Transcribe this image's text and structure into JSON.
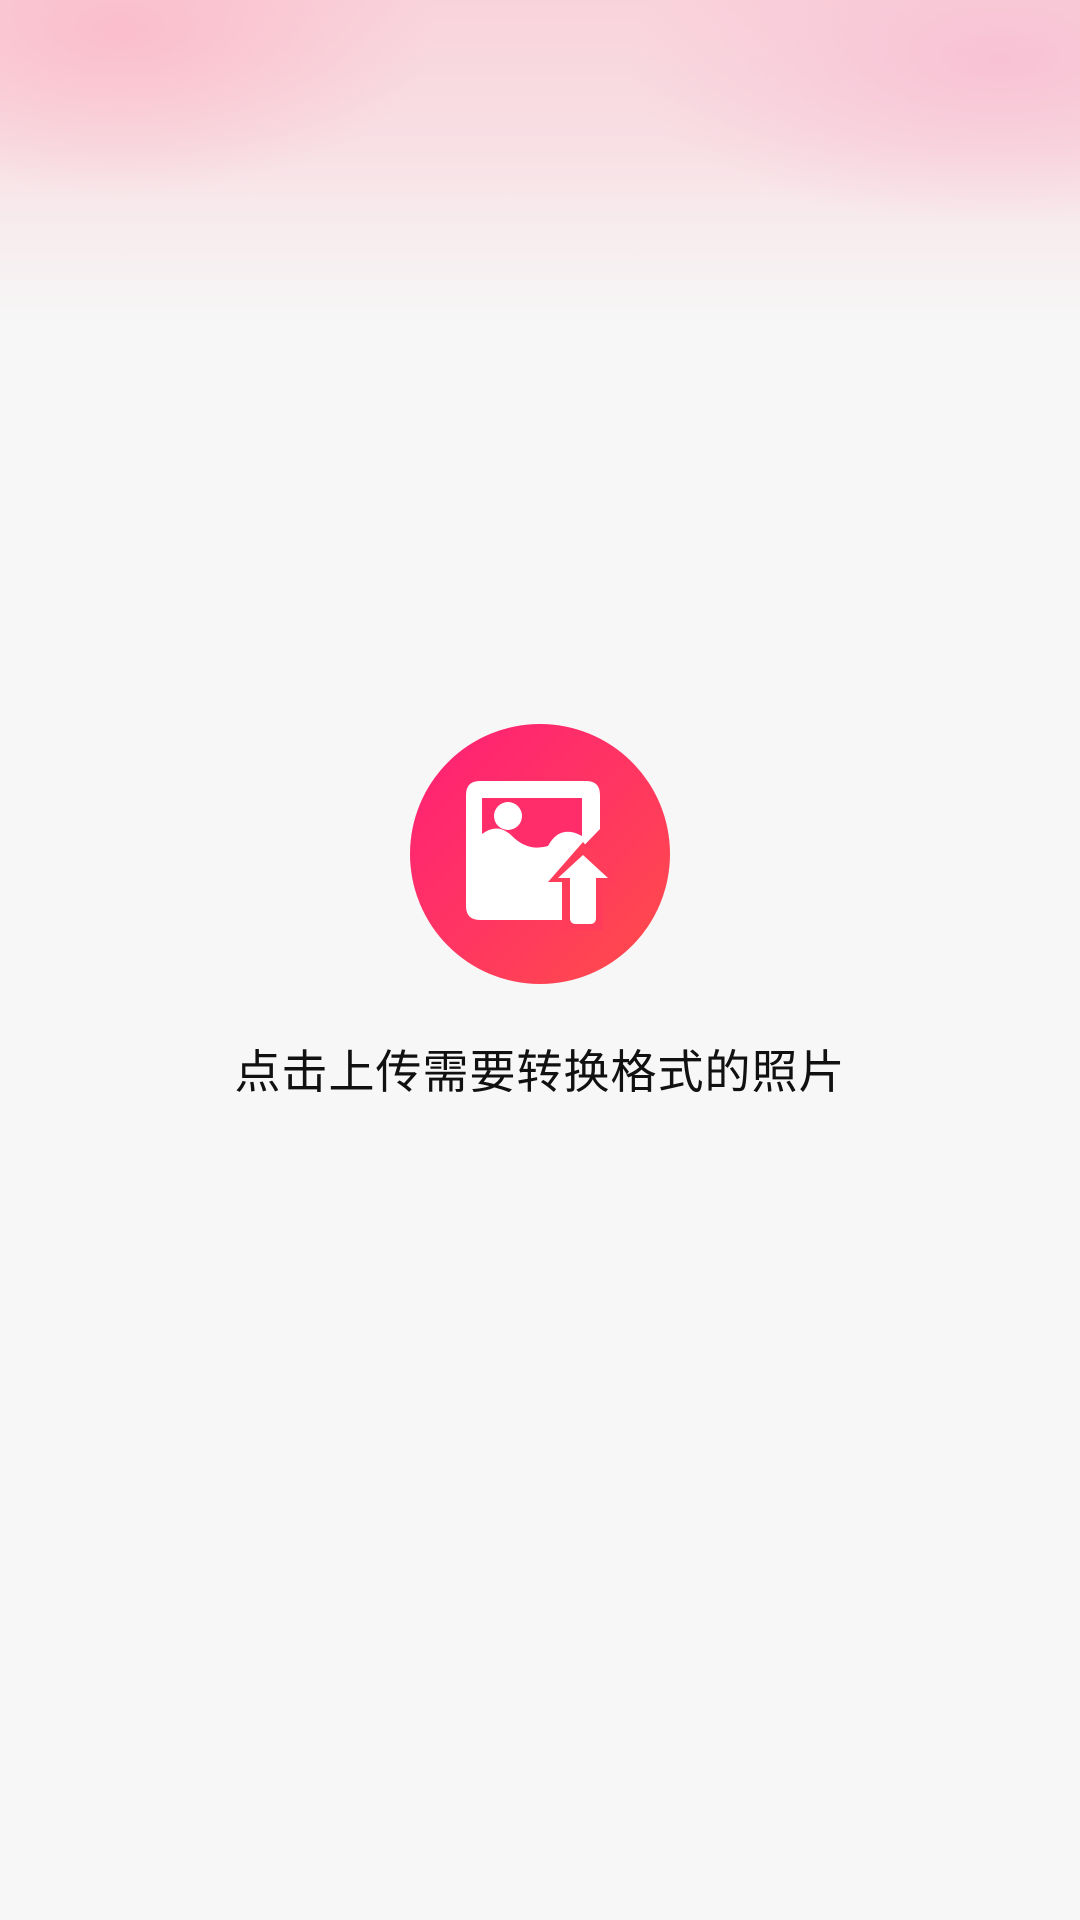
{
  "colors": {
    "background": "#f7f7f7",
    "accent_start": "#ff1f78",
    "accent_end": "#ff4e48",
    "text": "#111111"
  },
  "upload": {
    "icon": "image-upload-icon",
    "label": "点击上传需要转换格式的照片"
  }
}
